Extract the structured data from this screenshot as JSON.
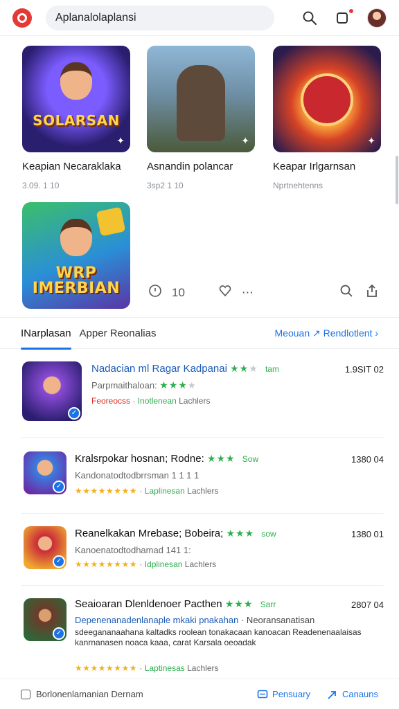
{
  "header": {
    "search_text": "Aplanalolaplansi",
    "icons": [
      "search-icon",
      "notification-icon",
      "avatar"
    ],
    "accent": "#e53935"
  },
  "featured": [
    {
      "title": "Keapian Necaraklaka",
      "sub": "3.09. 1 10",
      "word": "SOLARSAN"
    },
    {
      "title": "Asnandin polancar",
      "sub": "3sp2 1 10",
      "word": ""
    },
    {
      "title": "Keapar Irlgarnsan",
      "sub": "Nprtnehtenns",
      "word": ""
    },
    {
      "title": "",
      "sub": "",
      "word": "WRP IMERBIAN"
    }
  ],
  "featured_actions": {
    "count": "10"
  },
  "tabs": {
    "active": "INarplasan",
    "second": "Apper Reonalias",
    "link": "Meouan ↗ Rendlotlent ›"
  },
  "list": [
    {
      "title": "Nadacian ml Ragar Kadpanai",
      "tag": "tam",
      "sub": "Parpmaithaloan:",
      "meta_red": "Feoreocss",
      "meta_green": "Inotlenean",
      "meta_gray": "Lachlers",
      "date": "1.9SIT 02"
    },
    {
      "title": "Kralsrpokar hosnan; Rodne:",
      "tag": "Sow",
      "sub": "Kandonatodtodbrrsman 1 1 1 1",
      "meta_green": "Laplinesan",
      "meta_gray": "Lachlers",
      "date": "1380 04"
    },
    {
      "title": "Reanelkakan Mrebase; Bobeira;",
      "tag": "sow",
      "sub": "Kanoenatodtodhamad 141 1:",
      "meta_green": "Idplinesan",
      "meta_gray": "Lachlers",
      "date": "1380 01"
    },
    {
      "title": "Seaioaran Dlenldenoer Pacthen",
      "tag": "Sarr",
      "desc_link": "Depenenanadenlanaple mkaki pnakahan",
      "desc_link_tail": "· Neoransanatisan",
      "desc": "sdeegananaahana kaltadks roolean tonakacaan kanoacan Readenenaalaisas kanrnanasen noaca kaaa, carat Karsala oeoadak",
      "meta_green": "Laptinesas",
      "meta_gray": "Lachlers",
      "date": "2807 04"
    }
  ],
  "footer": {
    "left": "Borlonenlamanian Dernam",
    "btn1": "Pensuary",
    "btn2": "Canauns"
  }
}
